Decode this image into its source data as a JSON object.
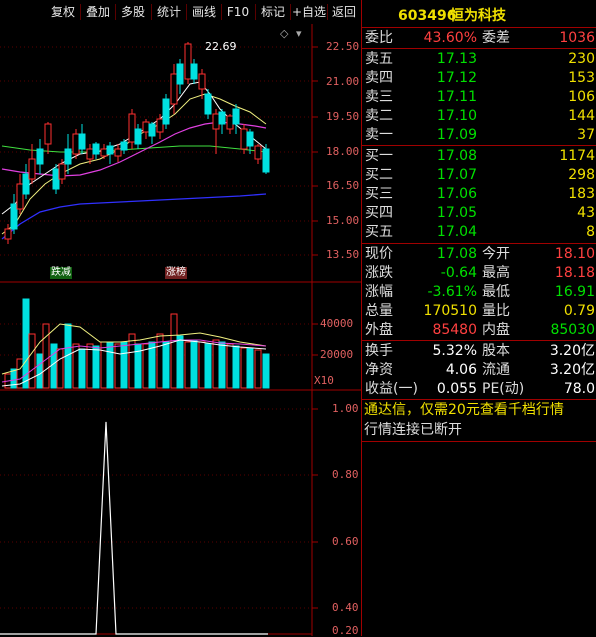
{
  "toolbar": {
    "buttons": [
      "复权",
      "叠加",
      "多股",
      "统计",
      "画线",
      "F10",
      "标记",
      "+自选",
      "返回"
    ]
  },
  "chart": {
    "price_axis": [
      "22.50",
      "21.00",
      "19.50",
      "18.00",
      "16.50",
      "15.00",
      "13.50"
    ],
    "volume_axis": [
      "40000",
      "20000"
    ],
    "volume_unit": "X10",
    "indicator_axis": [
      "1.00",
      "0.80",
      "0.60",
      "0.40",
      "0.20"
    ],
    "high_annotation": "22.69",
    "markers": [
      "跌减",
      "涨榜"
    ]
  },
  "chart_data": {
    "type": "candlestick",
    "price_ylim": [
      13.0,
      23.5
    ],
    "high_label": 22.69,
    "volume_ylim": [
      0,
      50000
    ],
    "indicator_ylim": [
      0,
      1.1
    ],
    "indicator_spike": {
      "value": 0.96
    }
  },
  "quote": {
    "code": "603496",
    "name": "恒为科技",
    "weibi_label": "委比",
    "weibi_value": "43.60%",
    "weicha_label": "委差",
    "weicha_value": "1036",
    "asks": [
      {
        "label": "卖五",
        "price": "17.13",
        "vol": "230"
      },
      {
        "label": "卖四",
        "price": "17.12",
        "vol": "153"
      },
      {
        "label": "卖三",
        "price": "17.11",
        "vol": "106"
      },
      {
        "label": "卖二",
        "price": "17.10",
        "vol": "144"
      },
      {
        "label": "卖一",
        "price": "17.09",
        "vol": "37"
      }
    ],
    "bids": [
      {
        "label": "买一",
        "price": "17.08",
        "vol": "1174"
      },
      {
        "label": "买二",
        "price": "17.07",
        "vol": "298"
      },
      {
        "label": "买三",
        "price": "17.06",
        "vol": "183"
      },
      {
        "label": "买四",
        "price": "17.05",
        "vol": "43"
      },
      {
        "label": "买五",
        "price": "17.04",
        "vol": "8"
      }
    ],
    "stats": [
      {
        "l1": "现价",
        "v1": "17.08",
        "c1": "dn",
        "l2": "今开",
        "v2": "18.10",
        "c2": "up"
      },
      {
        "l1": "涨跌",
        "v1": "-0.64",
        "c1": "dn",
        "l2": "最高",
        "v2": "18.18",
        "c2": "up"
      },
      {
        "l1": "涨幅",
        "v1": "-3.61%",
        "c1": "dn",
        "l2": "最低",
        "v2": "16.91",
        "c2": "dn"
      },
      {
        "l1": "总量",
        "v1": "170510",
        "c1": "yl",
        "l2": "量比",
        "v2": "0.79",
        "c2": "yl"
      },
      {
        "l1": "外盘",
        "v1": "85480",
        "c1": "up",
        "l2": "内盘",
        "v2": "85030",
        "c2": "dn"
      }
    ],
    "stats2": [
      {
        "l1": "换手",
        "v1": "5.32%",
        "l2": "股本",
        "v2": "3.20亿"
      },
      {
        "l1": "净资",
        "v1": "4.06",
        "l2": "流通",
        "v2": "3.20亿"
      },
      {
        "l1": "收益(一)",
        "v1": "0.055",
        "l2": "PE(动)",
        "v2": "78.0"
      }
    ],
    "notice": "通达信，仅需20元查看千档行情",
    "status": "行情连接已断开"
  }
}
